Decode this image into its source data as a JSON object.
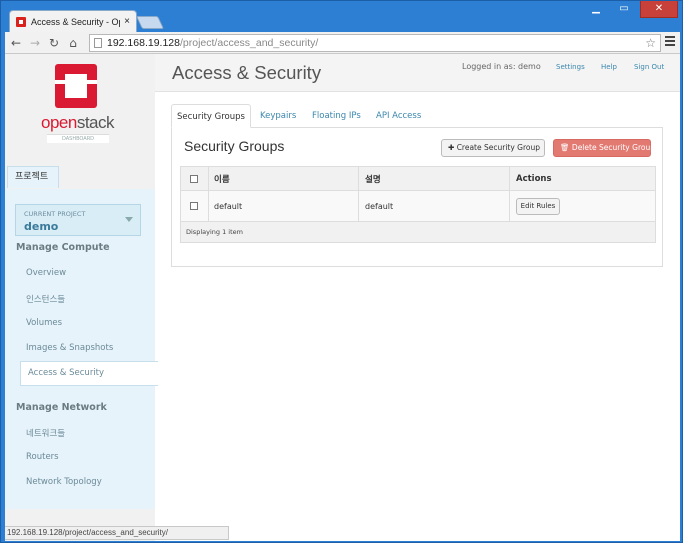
{
  "browser": {
    "tab_title": "Access & Security - Oper",
    "tab_close": "×",
    "url_host": "192.168.19.128",
    "url_path": "/project/access_and_security/",
    "status_url": "192.168.19.128/project/access_and_security/",
    "icons": [
      "back-icon",
      "forward-icon",
      "reload-icon",
      "home-icon",
      "page-icon",
      "star-icon",
      "menu-icon",
      "minimize-icon",
      "maximize-icon",
      "close-icon"
    ]
  },
  "brand": {
    "word_open": "open",
    "word_stack": "stack",
    "tagline": "DASHBOARD",
    "color": "#da1a32"
  },
  "sidebar": {
    "project_tab": "프로젝트",
    "current_project_label": "CURRENT PROJECT",
    "current_project": "demo",
    "sections": [
      {
        "title": "Manage Compute",
        "items": [
          "Overview",
          "인스턴스들",
          "Volumes",
          "Images & Snapshots",
          "Access & Security"
        ]
      },
      {
        "title": "Manage Network",
        "items": [
          "네트워크들",
          "Routers",
          "Network Topology"
        ]
      }
    ],
    "active_item": "Access & Security"
  },
  "header": {
    "title": "Access & Security",
    "logged_in": "Logged in as: demo",
    "links": [
      "Settings",
      "Help",
      "Sign Out"
    ]
  },
  "tabs": [
    "Security Groups",
    "Keypairs",
    "Floating IPs",
    "API Access"
  ],
  "panel": {
    "title": "Security Groups",
    "create_button": "Create Security Group",
    "delete_button": "Delete Security Groups",
    "columns": [
      "이름",
      "설명",
      "Actions"
    ],
    "rows": [
      {
        "name": "default",
        "description": "default",
        "action": "Edit Rules"
      }
    ],
    "footer": "Displaying 1 item"
  },
  "colors": {
    "link": "#3a87ad",
    "danger": "#e27a72",
    "sidebar": "#e6f3fa"
  }
}
